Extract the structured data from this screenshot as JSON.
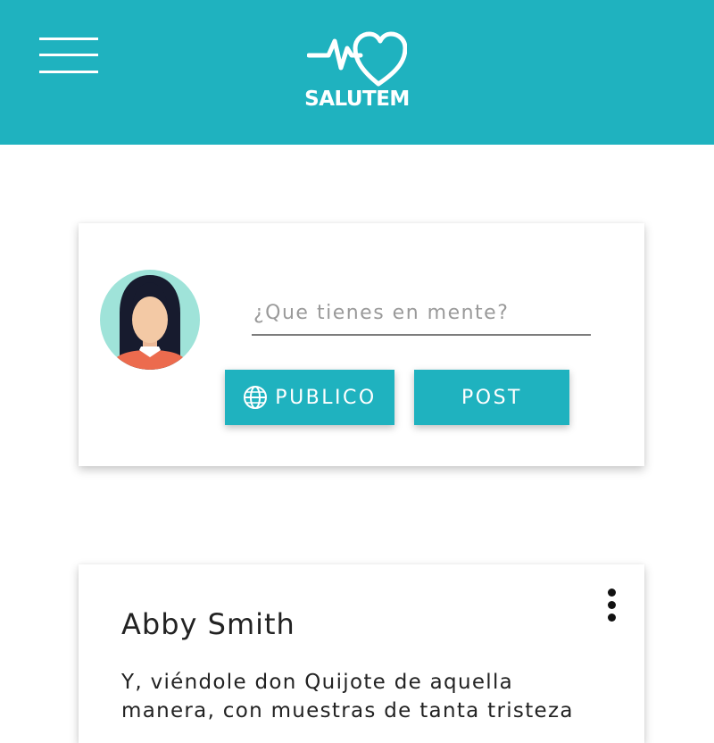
{
  "app": {
    "name": "SALUTEM"
  },
  "colors": {
    "primary": "#1fb2bf",
    "text": "#222222"
  },
  "header": {
    "menu_icon": "hamburger-menu-icon",
    "logo_icon": "heartbeat-heart-icon",
    "logo_text": "SALUTEM"
  },
  "composer": {
    "avatar_icon": "female-user-avatar",
    "placeholder": "¿Que tienes en mente?",
    "value": "",
    "visibility_icon": "globe-icon",
    "visibility_label": "PUBLICO",
    "post_label": "POST"
  },
  "post": {
    "author": "Abby Smith",
    "menu_icon": "more-vertical-icon",
    "body_lines": [
      "Y, viéndole don Quijote de aquella",
      "manera, con muestras de tanta tristeza"
    ]
  }
}
